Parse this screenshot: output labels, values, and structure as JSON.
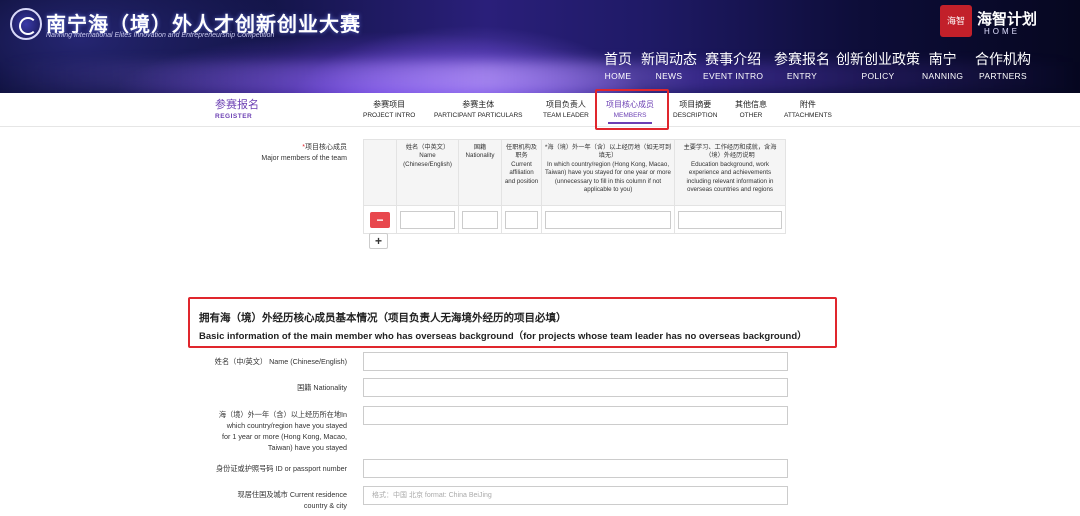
{
  "header": {
    "logo_title": "南宁海（境）外人才创新创业大赛",
    "logo_subtitle": "Nanning International Elites Innovation and Entrepreneurship Competition",
    "brand_seal": "海智",
    "brand_name": "海智计划",
    "brand_en": "HOME",
    "nav": [
      {
        "cn": "首页",
        "en": "HOME"
      },
      {
        "cn": "新闻动态",
        "en": "NEWS"
      },
      {
        "cn": "赛事介绍",
        "en": "EVENT INTRO"
      },
      {
        "cn": "参赛报名",
        "en": "ENTRY"
      },
      {
        "cn": "创新创业政策",
        "en": "POLICY"
      },
      {
        "cn": "南宁",
        "en": "NANNING"
      },
      {
        "cn": "合作机构",
        "en": "PARTNERS"
      }
    ]
  },
  "register": {
    "cn": "参赛报名",
    "en": "REGISTER"
  },
  "steps": [
    {
      "cn": "参赛项目",
      "en": "PROJECT INTRO"
    },
    {
      "cn": "参赛主体",
      "en": "PARTICIPANT PARTICULARS"
    },
    {
      "cn": "项目负责人",
      "en": "TEAM LEADER"
    },
    {
      "cn": "项目核心成员",
      "en": "MEMBERS"
    },
    {
      "cn": "项目摘要",
      "en": "DESCRIPTION"
    },
    {
      "cn": "其他信息",
      "en": "OTHER"
    },
    {
      "cn": "附件",
      "en": "ATTACHMENTS"
    }
  ],
  "members": {
    "label_star": "*",
    "label_cn": "项目核心成员",
    "label_en": "Major members of the team",
    "columns": [
      {
        "cn": "",
        "en": ""
      },
      {
        "cn": "姓名（中英文）",
        "en": "Name (Chinese/English)"
      },
      {
        "cn": "国籍",
        "en": "Nationality"
      },
      {
        "cn": "任职机构及职务",
        "en": "Current affiliation and position"
      },
      {
        "cn": "*海（境）外一年（含）以上经历地（如无可到填无）",
        "en": "In which country/region (Hong Kong, Macao, Taiwan) have you stayed for one year or more (unnecessary to fill in this column if not applicable to you)"
      },
      {
        "cn": "主要学习、工作经历和成就，含海（境）外经历说明",
        "en": "Education background, work experience and achievements including relevant information in overseas countries and regions"
      }
    ],
    "remove_label": "−",
    "add_label": "+"
  },
  "overseas": {
    "title_cn": "拥有海（境）外经历核心成员基本情况（项目负责人无海境外经历的项目必填）",
    "title_en": "Basic information of the main member who has overseas background（for projects whose team leader has no overseas background）",
    "fields": [
      {
        "label": [
          "姓名（中/英文） Name (Chinese/English)"
        ],
        "placeholder": ""
      },
      {
        "label": [
          "国籍 Nationality"
        ],
        "placeholder": ""
      },
      {
        "label": [
          "海（境）外一年（含）以上经历所在地In",
          "which country/region have you stayed",
          "for 1 year or more (Hong Kong, Macao,",
          "Taiwan) have you stayed"
        ],
        "placeholder": ""
      },
      {
        "label": [
          "身份证或护照号码 ID or passport number"
        ],
        "placeholder": ""
      },
      {
        "label": [
          "现居住国及城市 Current residence",
          "country & city"
        ],
        "placeholder": "格式：中国 北京 format: China BeiJing"
      }
    ]
  }
}
